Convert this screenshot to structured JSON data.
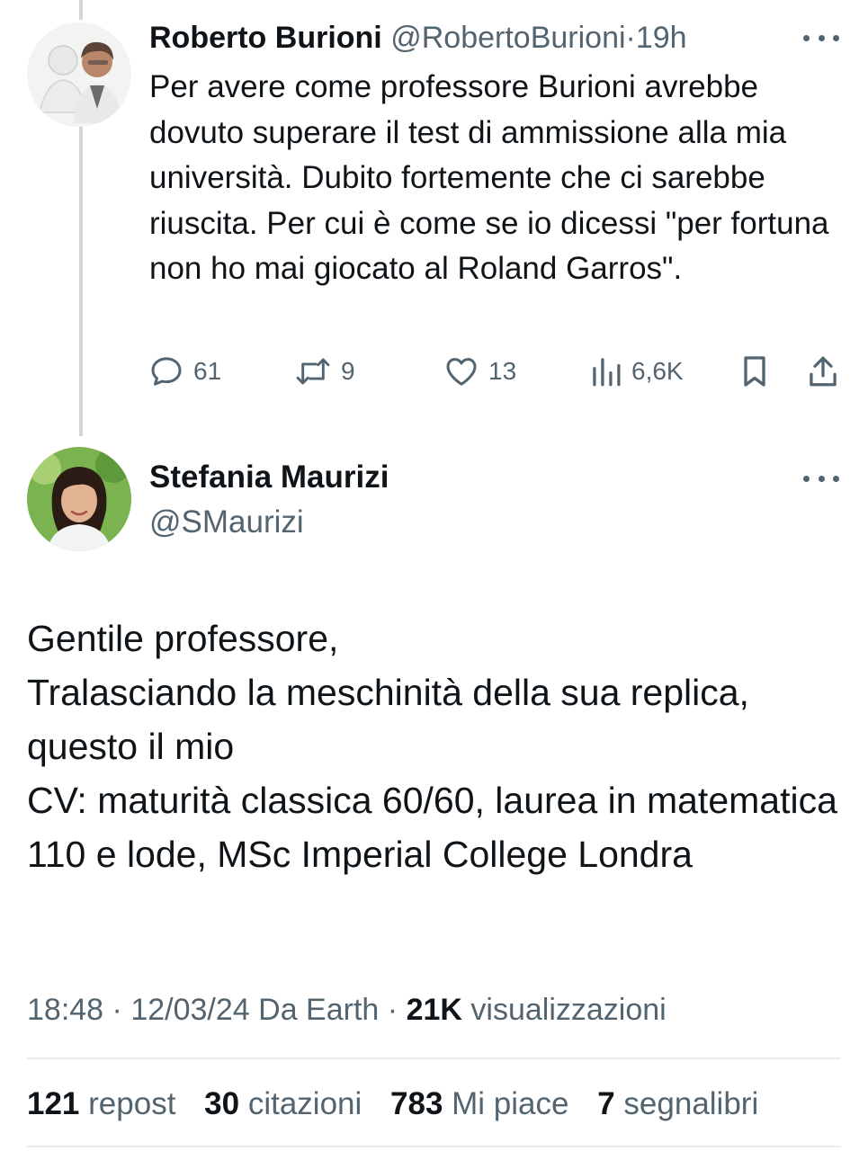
{
  "tweet_reply_to": {
    "author_name": "Roberto Burioni",
    "author_handle": "@RobertoBurioni",
    "separator": "·",
    "age": "19h",
    "text": "Per avere come professore Burioni avrebbe dovuto superare il test di ammissione alla mia università. Dubito fortemente che ci sarebbe riuscita. Per cui è come se io dicessi \"per fortuna non ho mai giocato al Roland Garros\".",
    "actions": {
      "replies": "61",
      "reposts": "9",
      "likes": "13",
      "views": "6,6K"
    },
    "icons": [
      "reply-icon",
      "repost-icon",
      "like-icon",
      "views-icon",
      "bookmark-icon",
      "share-icon",
      "more-icon"
    ]
  },
  "tweet_main": {
    "author_name": "Stefania Maurizi",
    "author_handle": "@SMaurizi",
    "text": "Gentile professore,\nTralasciando la meschinità della sua replica, questo il mio\n CV: maturità classica 60/60, laurea in matematica 110 e lode, MSc Imperial College Londra",
    "time": "18:48",
    "date": "12/03/24",
    "source": "Da Earth",
    "views_count": "21K",
    "views_label": "visualizzazioni",
    "sep": "·",
    "stats": {
      "reposts_count": "121",
      "reposts_label": "repost",
      "quotes_count": "30",
      "quotes_label": "citazioni",
      "likes_count": "783",
      "likes_label": "Mi piace",
      "bookmarks_count": "7",
      "bookmarks_label": "segnalibri"
    }
  },
  "colors": {
    "text": "#0f1419",
    "muted": "#536471",
    "divider": "#e6ecf0",
    "thread_line": "#d0d7dc"
  }
}
